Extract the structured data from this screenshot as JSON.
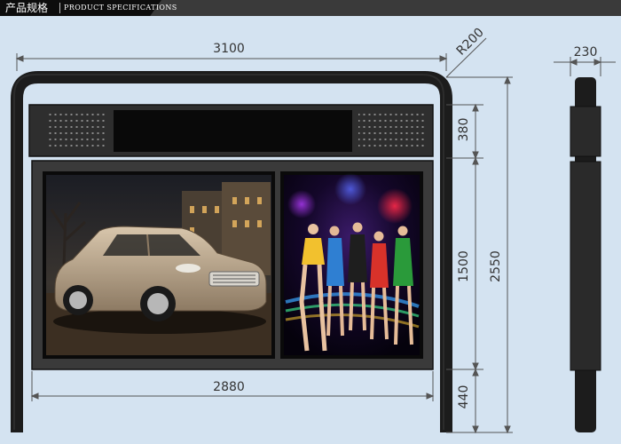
{
  "header": {
    "title_cn": "产品规格",
    "title_en": "PRODUCT SPECIFICATIONS"
  },
  "dimensions": {
    "overall_width": "3100",
    "corner_radius": "R200",
    "depth": "230",
    "header_height": "380",
    "panel_height": "1500",
    "total_height": "2550",
    "base_height": "440",
    "panel_width": "2880"
  },
  "posters": {
    "left": "car-advertisement-photo",
    "right": "group-of-dancers-advertisement-photo"
  },
  "colors": {
    "background": "#d4e3f1",
    "frame": "#1c1c1c",
    "header_box": "#2e2e2e",
    "dimension_line": "#555555"
  }
}
